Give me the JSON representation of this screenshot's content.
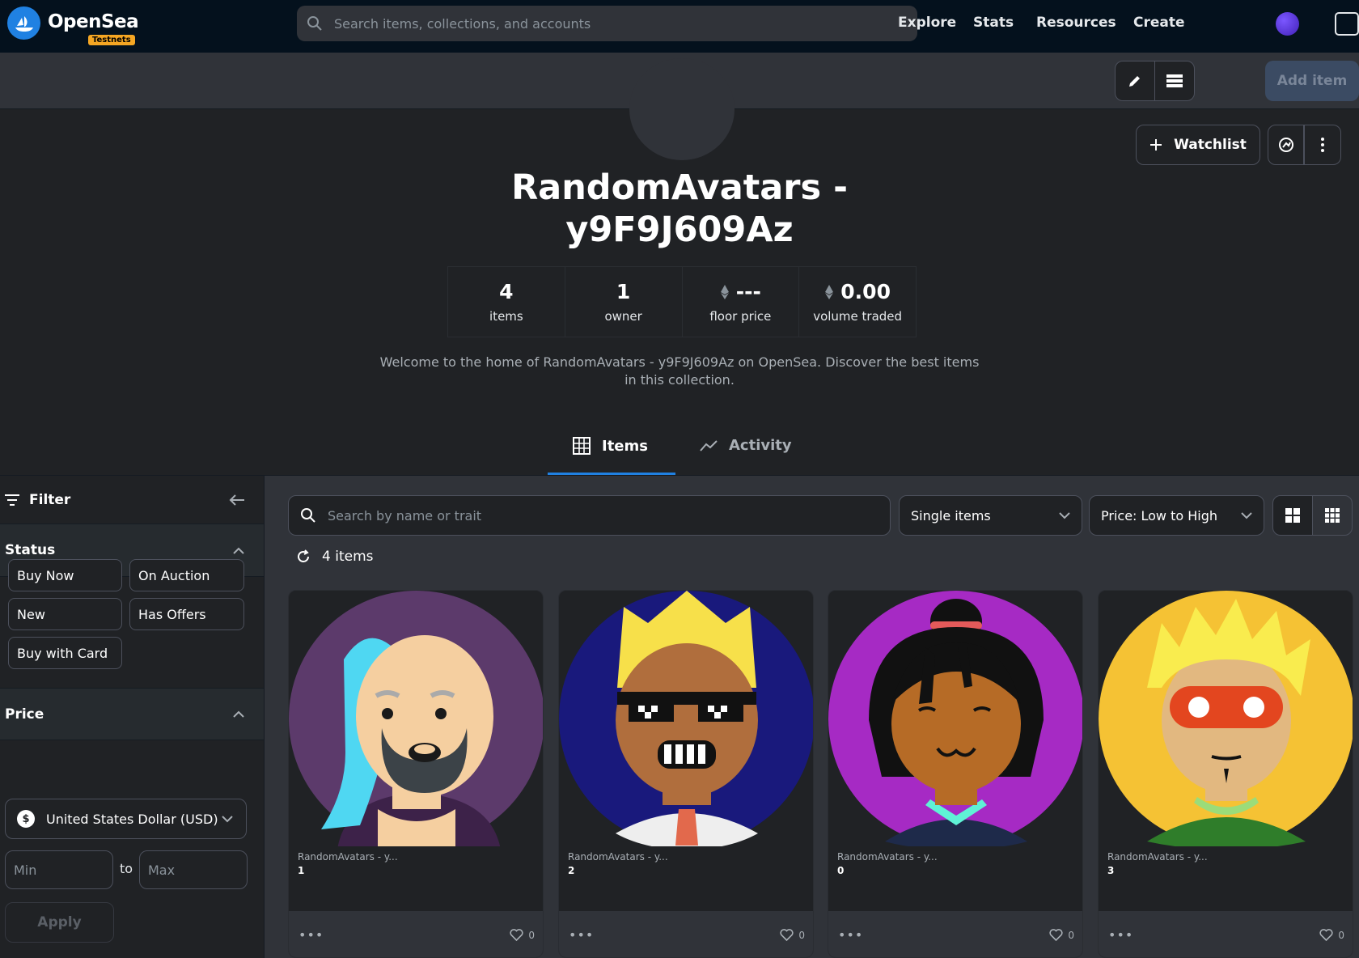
{
  "nav": {
    "brand": "OpenSea",
    "badge": "Testnets",
    "search_placeholder": "Search items, collections, and accounts",
    "links": [
      "Explore",
      "Stats",
      "Resources",
      "Create"
    ]
  },
  "toolbar": {
    "add_item": "Add item"
  },
  "collection": {
    "watchlist": "Watchlist",
    "title_line1": "RandomAvatars -",
    "title_line2": "y9F9J609Az",
    "stats": [
      {
        "value": "4",
        "label": "items"
      },
      {
        "value": "1",
        "label": "owner"
      },
      {
        "value": "---",
        "label": "floor price"
      },
      {
        "value": "0.00",
        "label": "volume traded"
      }
    ],
    "description": "Welcome to the home of RandomAvatars - y9F9J609Az on OpenSea. Discover the best items in this collection."
  },
  "tabs": [
    {
      "label": "Items"
    },
    {
      "label": "Activity"
    }
  ],
  "sidebar": {
    "filter": "Filter",
    "status": "Status",
    "status_chips": [
      "Buy Now",
      "On Auction",
      "New",
      "Has Offers",
      "Buy with Card"
    ],
    "price": "Price",
    "currency": "United States Dollar (USD)",
    "min_placeholder": "Min",
    "to": "to",
    "max_placeholder": "Max",
    "apply": "Apply"
  },
  "main": {
    "search_placeholder": "Search by name or trait",
    "type_select": "Single items",
    "sort_select": "Price: Low to High",
    "count": "4 items"
  },
  "cards": [
    {
      "collection": "RandomAvatars - y...",
      "id": "1",
      "likes": "0"
    },
    {
      "collection": "RandomAvatars - y...",
      "id": "2",
      "likes": "0"
    },
    {
      "collection": "RandomAvatars - y...",
      "id": "0",
      "likes": "0"
    },
    {
      "collection": "RandomAvatars - y...",
      "id": "3",
      "likes": "0"
    }
  ],
  "colors": {
    "accent": "#2081e2",
    "nav_bg": "#04111d",
    "badge": "#f5a623"
  }
}
